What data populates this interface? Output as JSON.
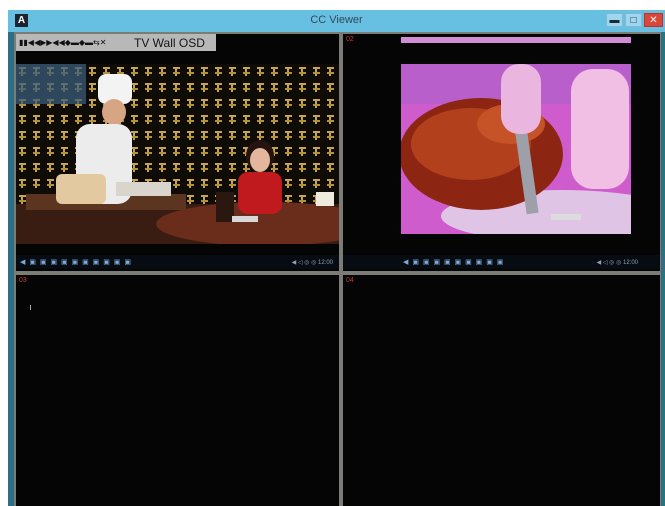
{
  "window": {
    "icon_letter": "A",
    "title": "CC Viewer",
    "min_icon": "minimize-icon",
    "max_icon": "maximize-icon",
    "close_icon": "close-icon",
    "min_glyph": "▬",
    "max_glyph": "□",
    "close_glyph": "✕"
  },
  "osd": {
    "label": "TV Wall OSD",
    "icon_glyphs": "▮▮◀◀▶▶◀◀◆▬◆▬⇆✕"
  },
  "panes": [
    {
      "label": "01",
      "bar_icons": "◀ ▣ ▣ ▣ ▣ ▣ ▣ ▣ ▣ ▣ ▣",
      "bar_right": "◀ ◁ ◎ ◎ 12:00"
    },
    {
      "label": "02",
      "bar_icons": "◀ ▣ ▣ ▣ ▣ ▣ ▣ ▣ ▣ ▣",
      "bar_right": "◀ ◁ ◎ ◎ 12:00"
    },
    {
      "label": "03"
    },
    {
      "label": "04"
    }
  ],
  "colors": {
    "titlebar": "#67bfe2",
    "window_frame": "#2f6f86",
    "pane_label": "#c33c3c",
    "close_button": "#d9463a"
  }
}
